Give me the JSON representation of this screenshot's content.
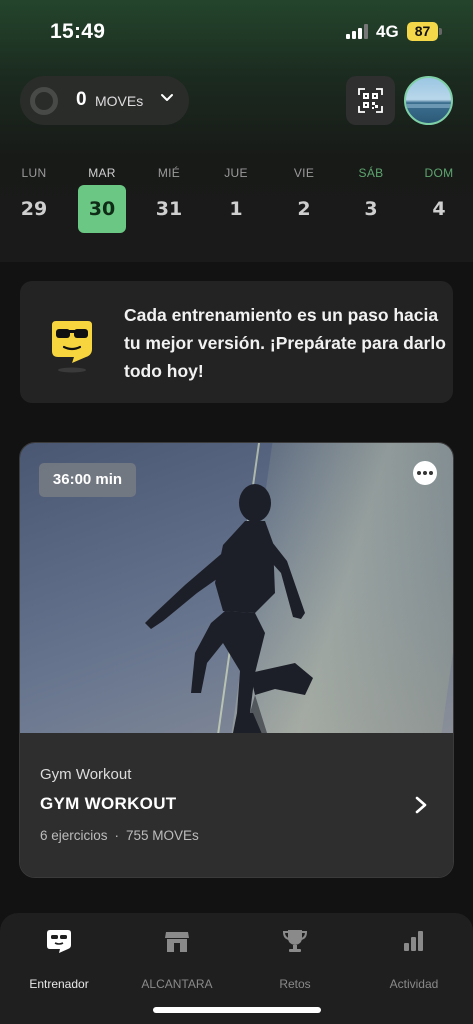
{
  "status_bar": {
    "time": "15:49",
    "network": "4G",
    "battery": "87"
  },
  "header": {
    "moves_count": "0",
    "moves_label": "MOVEs",
    "icons": {
      "qr": "qr-code-icon",
      "chevron": "chevron-down-icon"
    }
  },
  "week": {
    "days": [
      {
        "name": "LUN",
        "num": "29"
      },
      {
        "name": "MAR",
        "num": "30",
        "selected": true
      },
      {
        "name": "MIÉ",
        "num": "31"
      },
      {
        "name": "JUE",
        "num": "1"
      },
      {
        "name": "VIE",
        "num": "2"
      },
      {
        "name": "SÁB",
        "num": "3",
        "weekend": true
      },
      {
        "name": "DOM",
        "num": "4",
        "weekend": true
      }
    ],
    "accent_color": "#6bc784"
  },
  "coach": {
    "message": "Cada entrenamiento es un paso hacia tu mejor versión. ¡Prepárate para darlo todo hoy!",
    "icon": "sunglasses-face-icon"
  },
  "workout": {
    "duration": "36:00 min",
    "category": "Gym Workout",
    "title": "GYM WORKOUT",
    "exercises": "6 ejercicios",
    "separator": "·",
    "moves": "755 MOVEs"
  },
  "nav": {
    "items": [
      {
        "label": "Entrenador",
        "icon": "coach-face-icon",
        "active": true
      },
      {
        "label": "ALCANTARA",
        "icon": "store-icon"
      },
      {
        "label": "Retos",
        "icon": "trophy-icon"
      },
      {
        "label": "Actividad",
        "icon": "bar-chart-icon"
      }
    ]
  }
}
